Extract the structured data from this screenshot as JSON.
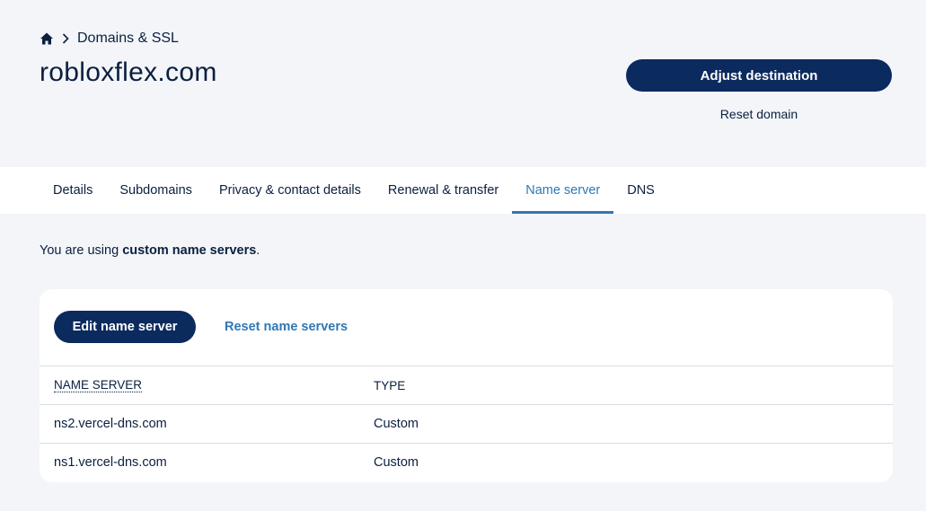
{
  "breadcrumb": {
    "home_icon": "home-icon",
    "separator_icon": "chevron-right-icon",
    "section": "Domains & SSL"
  },
  "domain": {
    "title": "robloxflex.com"
  },
  "actions": {
    "adjust_destination": "Adjust destination",
    "reset_domain": "Reset domain"
  },
  "tabs": [
    {
      "label": "Details",
      "active": false
    },
    {
      "label": "Subdomains",
      "active": false
    },
    {
      "label": "Privacy & contact details",
      "active": false
    },
    {
      "label": "Renewal & transfer",
      "active": false
    },
    {
      "label": "Name server",
      "active": true
    },
    {
      "label": "DNS",
      "active": false
    }
  ],
  "info": {
    "prefix": "You are using ",
    "emphasis": "custom name servers",
    "suffix": "."
  },
  "card": {
    "edit_button": "Edit name server",
    "reset_link": "Reset name servers",
    "headers": {
      "name": "NAME SERVER",
      "type": "TYPE"
    },
    "rows": [
      {
        "name": "ns2.vercel-dns.com",
        "type": "Custom"
      },
      {
        "name": "ns1.vercel-dns.com",
        "type": "Custom"
      }
    ]
  },
  "colors": {
    "primary": "#0b2a5e",
    "accent": "#2f78b5",
    "text": "#0b1f3f",
    "background": "#f3f5f9"
  }
}
